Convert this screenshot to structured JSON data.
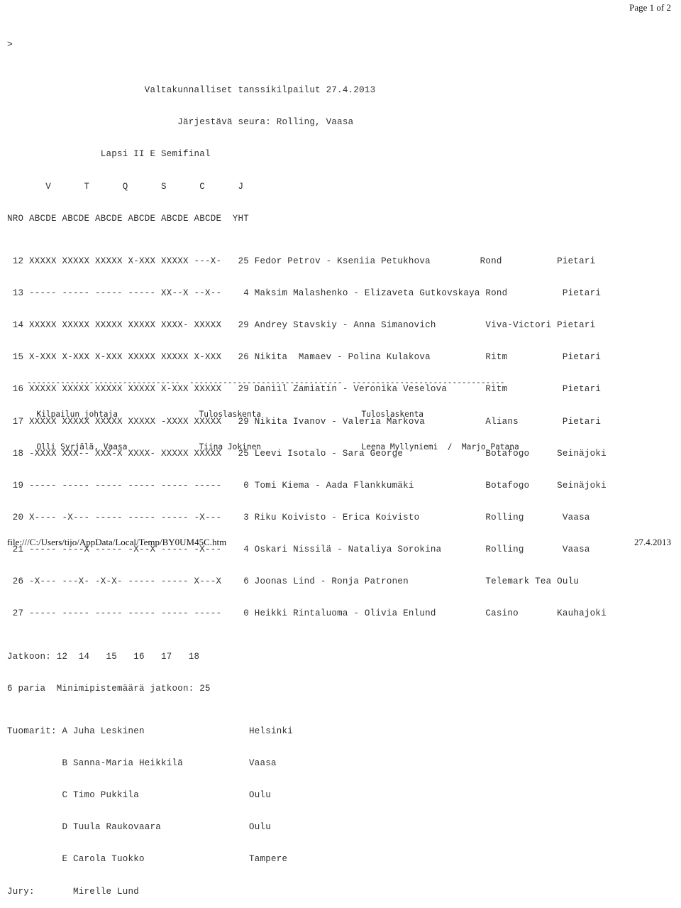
{
  "browser": {
    "page_label": "Page 1 of 2",
    "file_path": "file:///C:/Users/tijo/AppData/Local/Temp/BY0UM45C.htm",
    "print_date": "27.4.2013"
  },
  "prompt": {
    "caret": ">"
  },
  "report": {
    "title_line": "                         Valtakunnalliset tanssikilpailut 27.4.2013",
    "organizer_line": "                               Järjestävä seura: Rolling, Vaasa",
    "event_line": "                 Lapsi II E Semifinal",
    "dance_header_line": "       V      T      Q      S      C      J",
    "column_header_line": "NRO ABCDE ABCDE ABCDE ABCDE ABCDE ABCDE  YHT",
    "rows": [
      " 12 XXXXX XXXXX XXXXX X-XXX XXXXX ---X-   25 Fedor Petrov - Kseniia Petukhova         Rond          Pietari",
      " 13 ----- ----- ----- ----- XX--X --X--    4 Maksim Malashenko - Elizaveta Gutkovskaya Rond          Pietari",
      " 14 XXXXX XXXXX XXXXX XXXXX XXXX- XXXXX   29 Andrey Stavskiy - Anna Simanovich         Viva-Victori Pietari",
      " 15 X-XXX X-XXX X-XXX XXXXX XXXXX X-XXX   26 Nikita  Mamaev - Polina Kulakova          Ritm          Pietari",
      " 16 XXXXX XXXXX XXXXX XXXXX X-XXX XXXXX   29 Daniil Zamiatin - Veronika Veselova       Ritm          Pietari",
      " 17 XXXXX XXXXX XXXXX XXXXX -XXXX XXXXX   29 Nikita Ivanov - Valeria Markova           Alians        Pietari",
      " 18 -XXXX XXX-- XXX-X XXXX- XXXXX XXXXX   25 Leevi Isotalo - Sara George               Botafogo     Seinäjoki",
      " 19 ----- ----- ----- ----- ----- -----    0 Tomi Kiema - Aada Flankkumäki             Botafogo     Seinäjoki",
      " 20 X---- -X--- ----- ----- ----- -X---    3 Riku Koivisto - Erica Koivisto            Rolling       Vaasa",
      " 21 ----- ----X ----- -X--X ----- -X---    4 Oskari Nissilä - Nataliya Sorokina        Rolling       Vaasa",
      " 26 -X--- ---X- -X-X- ----- ----- X---X    6 Joonas Lind - Ronja Patronen              Telemark Tea Oulu",
      " 27 ----- ----- ----- ----- ----- -----    0 Heikki Rintaluoma - Olivia Enlund         Casino       Kauhajoki"
    ],
    "advance_line": "Jatkoon: 12  14   15   16   17   18",
    "pairs_line": "6 paria  Minimipistemäärä jatkoon: 25",
    "judges_lines": [
      "Tuomarit: A Juha Leskinen                   Helsinki",
      "          B Sanna-Maria Heikkilä            Vaasa",
      "          C Timo Pukkila                    Oulu",
      "          D Tuula Raukovaara                Oulu",
      "          E Carola Tuokko                   Tampere"
    ],
    "jury_line": "Jury:       Mirelle Lund"
  },
  "signatures": {
    "rule_line": "--------------------------------  --------------------------------  --------------------------------",
    "role_line": "  Kilpailun johtaja                 Tuloslaskenta                     Tuloslaskenta",
    "name_line": "  Olli Syrjälä, Vaasa               Tiina Jokinen                     Leena Myllyniemi  /  Marjo Patana"
  }
}
